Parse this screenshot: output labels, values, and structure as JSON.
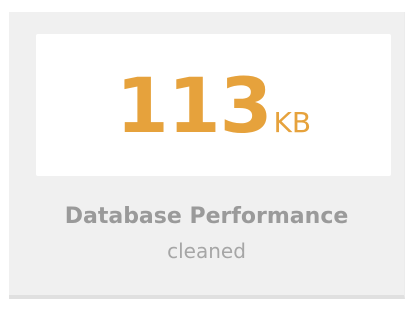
{
  "stat": {
    "value": "113",
    "unit": "KB",
    "title": "Database Performance",
    "subtitle": "cleaned",
    "accent_color": "#e6a23c"
  }
}
